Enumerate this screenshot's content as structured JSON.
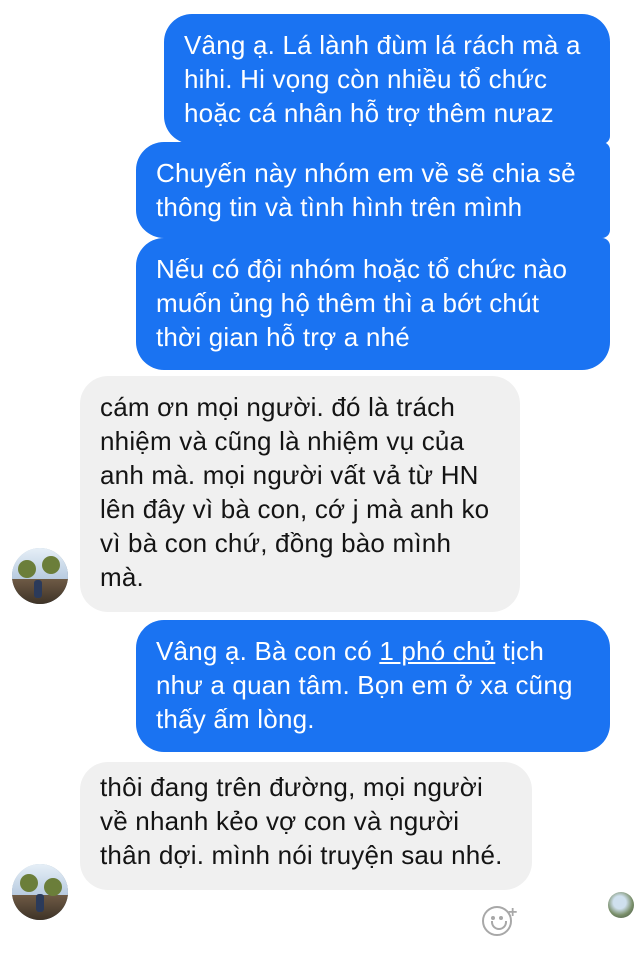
{
  "messages": [
    {
      "side": "out",
      "text": "Vâng ạ. Lá lành đùm lá rách mà a hihi. Hi vọng còn nhiều tổ chức hoặc cá nhân hỗ trợ thêm nưaz"
    },
    {
      "side": "out",
      "text": "Chuyến này nhóm em về sẽ chia sẻ thông tin và tình hình trên mình"
    },
    {
      "side": "out",
      "text": "Nếu có đội nhóm hoặc tổ chức nào muốn ủng hộ thêm thì a bớt chút thời gian hỗ trợ a nhé"
    },
    {
      "side": "in",
      "text": "cám ơn mọi người. đó là trách nhiệm và cũng là nhiệm vụ của anh mà. mọi người vất vả từ HN lên đây vì bà con, cớ j mà anh ko vì bà con chứ, đồng bào mình mà."
    },
    {
      "side": "out",
      "text_before": "Vâng ạ. Bà con có ",
      "link": "1 phó chủ",
      "text_after": " tịch như a quan tâm. Bọn em ở xa cũng thấy ấm lòng."
    },
    {
      "side": "in",
      "text": "thôi đang trên đường, mọi người về nhanh kẻo vợ con và người thân dợi. mình nói truyện sau nhé."
    }
  ],
  "icons": {
    "avatar": "contact-avatar-photo",
    "read_receipt": "read-receipt-avatar",
    "reaction": "add-reaction-smiley-icon"
  },
  "colors": {
    "outgoing_bubble": "#1a73f2",
    "incoming_bubble": "#f0f0f0",
    "outgoing_text": "#ffffff",
    "incoming_text": "#141414"
  }
}
